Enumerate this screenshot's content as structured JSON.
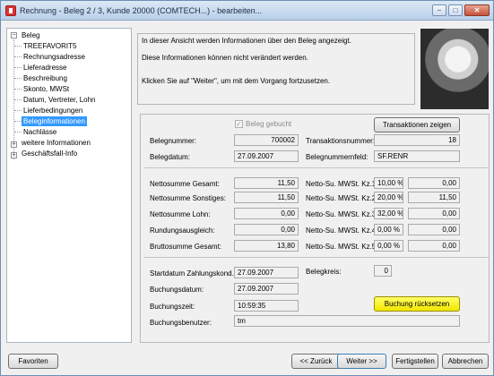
{
  "window": {
    "title": "Rechnung - Beleg 2 / 3, Kunde 20000 (COMTECH...) - bearbeiten...",
    "min": "−",
    "max": "□",
    "close": "✕"
  },
  "tree": {
    "root": "Beleg",
    "items": [
      "TREEFAVORIT5",
      "Rechnungsadresse",
      "Lieferadresse",
      "Beschreibung",
      "Skonto, MWSt",
      "Datum, Vertreter, Lohn",
      "Lieferbedingungen",
      "Beleginformationen",
      "Nachlässe"
    ],
    "more": "weitere Informationen",
    "business": "Geschäftsfall-Info"
  },
  "info": {
    "line1": "In dieser Ansicht werden Informationen über den Beleg angezeigt.",
    "line2": "Diese Informationen können nicht verändert werden.",
    "line3": "Klicken Sie auf \"Weiter\", um mit dem Vorgang fortzusetzen."
  },
  "beleg": {
    "gebucht_label": "Beleg gebucht",
    "transaktionen_button": "Transaktionen zeigen",
    "belegnummer_label": "Belegnummer:",
    "belegnummer": "700002",
    "transaktionsnummer_label": "Transaktionsnummer:",
    "transaktionsnummer": "18",
    "belegdatum_label": "Belegdatum:",
    "belegdatum": "27.09.2007",
    "belegnummernfeld_label": "Belegnummernfeld:",
    "belegnummernfeld": "SF.RENR"
  },
  "sums": {
    "left": [
      {
        "label": "Nettosumme Gesamt:",
        "value": "11,50"
      },
      {
        "label": "Nettosumme Sonstiges:",
        "value": "11,50"
      },
      {
        "label": "Nettosumme Lohn:",
        "value": "0,00"
      },
      {
        "label": "Rundungsausgleich:",
        "value": "0,00"
      },
      {
        "label": "Bruttosumme Gesamt:",
        "value": "13,80"
      }
    ],
    "right": [
      {
        "label": "Netto-Su. MWSt. Kz.1:",
        "pct": "10,00 %",
        "value": "0,00"
      },
      {
        "label": "Netto-Su. MWSt. Kz.2:",
        "pct": "20,00 %",
        "value": "11,50"
      },
      {
        "label": "Netto-Su. MWSt. Kz.3:",
        "pct": "32,00 %",
        "value": "0,00"
      },
      {
        "label": "Netto-Su. MWSt. Kz.4:",
        "pct": "0,00 %",
        "value": "0,00"
      },
      {
        "label": "Netto-Su. MWSt. Kz.5:",
        "pct": "0,00 %",
        "value": "0,00"
      }
    ]
  },
  "booking": {
    "startdatum_label": "Startdatum Zahlungskond.:",
    "startdatum": "27.09.2007",
    "belegkreis_label": "Belegkreis:",
    "belegkreis": "0",
    "buchungsdatum_label": "Buchungsdatum:",
    "buchungsdatum": "27.09.2007",
    "buchungszeit_label": "Buchungszeit:",
    "buchungszeit": "10:59:35",
    "buchungsbenutzer_label": "Buchungsbenutzer:",
    "buchungsbenutzer": "tm",
    "reset_button": "Buchung rücksetzen"
  },
  "footer": {
    "favoriten": "Favoriten",
    "zurueck": "<< Zurück",
    "weiter": "Weiter >>",
    "fertigstellen": "Fertigstellen",
    "abbrechen": "Abbrechen"
  },
  "colors": {
    "selection": "#3399ff",
    "highlight_button": "#f2e600"
  }
}
